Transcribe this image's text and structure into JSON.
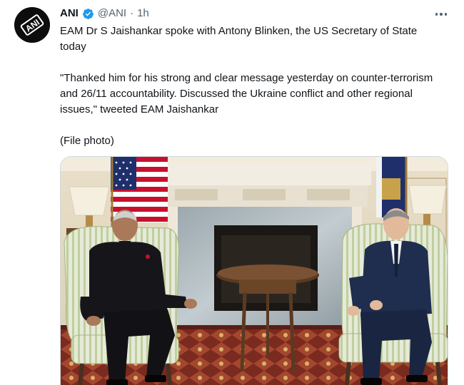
{
  "tweet": {
    "author_name": "ANI",
    "handle": "@ANI",
    "separator": "·",
    "time": "1h",
    "text_p1": "EAM Dr S Jaishankar spoke with Antony Blinken, the US Secretary of State today",
    "text_p2": "\"Thanked him for his strong and clear message yesterday on counter-terrorism and 26/11 accountability. Discussed the Ukraine conflict and other regional issues,\" tweeted EAM Jaishankar",
    "text_p3": "(File photo)"
  },
  "icons": {
    "avatar": "ani-logo-icon",
    "verified": "verified-badge-icon",
    "more": "more-options-icon"
  },
  "colors": {
    "verified_blue": "#1d9bf0",
    "text_primary": "#0f1419",
    "text_secondary": "#536471",
    "border": "#cfd9de"
  }
}
